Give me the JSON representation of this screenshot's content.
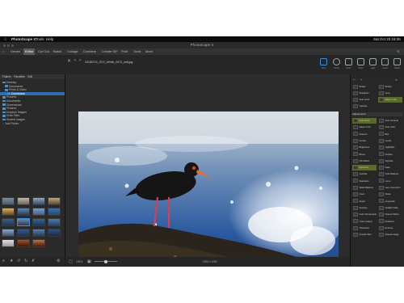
{
  "menubar": {
    "apple": "",
    "app_name": "PhotoScape X",
    "items": [
      "Tools",
      "Help"
    ],
    "clock": "Sat Oct 20 18:35"
  },
  "titlebar": {
    "title": "PhotoScape X"
  },
  "tabs": [
    "Viewer",
    "Editor",
    "Cut Out",
    "Batch",
    "Collage",
    "Combine",
    "Create GIF",
    "Print",
    "Tools",
    "More"
  ],
  "active_tab": "Editor",
  "left_panel": {
    "header_tabs": [
      "Folders",
      "Favorites",
      "Edit"
    ],
    "tree": [
      "Desktop",
      "Documents",
      "Photo & Video",
      "Downloads",
      "Pictures",
      "Documents",
      "Screenshots",
      "Pictures",
      "Dropbox Images",
      "Drive Files",
      "Shared Images",
      "Add Folder"
    ],
    "selected_index": 3
  },
  "document": {
    "filename": "20180715_SCS_Whitie_0072_edit.jpg",
    "size_readout": "1920 x 1280",
    "zoom": "100%"
  },
  "toolbar": [
    "Crop",
    "Circle",
    "Color",
    "Filter",
    "Light",
    "Insert",
    "Object",
    "Tools"
  ],
  "right_panel": {
    "top_items": [
      "Rotate",
      "Resize",
      "Straighten",
      "Crop",
      "Auto Level",
      "Magic Color",
      "Vignette"
    ],
    "section_label": "Adjustments",
    "items": [
      "Auto Level",
      "Auto Contrast",
      "Magic Color",
      "Auto Color",
      "Sharpen",
      "Blur",
      "Curves",
      "Levels",
      "Brightness",
      "Highlights",
      "Bloom",
      "Dehaze",
      "Film Effect",
      "Vignette",
      "Exposure",
      "Fade",
      "Hue/Sat",
      "Color Balance",
      "Saturation",
      "Lomo",
      "White Balance",
      "Lens Correction",
      "Invert",
      "Noise",
      "Sepia",
      "Grayscale",
      "Duotone",
      "Gradient Map",
      "Color Temperature",
      "Channel Mixer",
      "Color Lookup",
      "Posterize",
      "Threshold",
      "Emboss",
      "Smooth Skin",
      "Sharpen Edge"
    ]
  },
  "colors": {
    "accent": "#3d8fe0",
    "highlight_item": "#5a6a2a"
  }
}
